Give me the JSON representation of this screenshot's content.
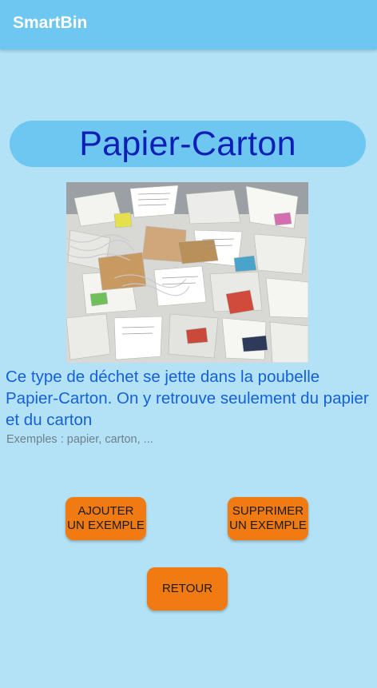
{
  "app": {
    "title": "SmartBin"
  },
  "category": {
    "title": "Papier-Carton",
    "image_subject": "pile of paper and cardboard waste",
    "description": "Ce type de déchet se jette dans la poubelle Papier-Carton. On y retrouve seulement du papier et du carton",
    "examples": "Exemples : papier, carton, ..."
  },
  "buttons": {
    "add_line1": "AJOUTER",
    "add_line2": "UN EXEMPLE",
    "delete_line1": "SUPPRIMER",
    "delete_line2": "UN EXEMPLE",
    "back": "RETOUR"
  },
  "colors": {
    "background": "#b3e2f7",
    "app_bar": "#6ec7f0",
    "title_text": "#0f1fb6",
    "description_text": "#1460d8",
    "button": "#f07b12"
  }
}
